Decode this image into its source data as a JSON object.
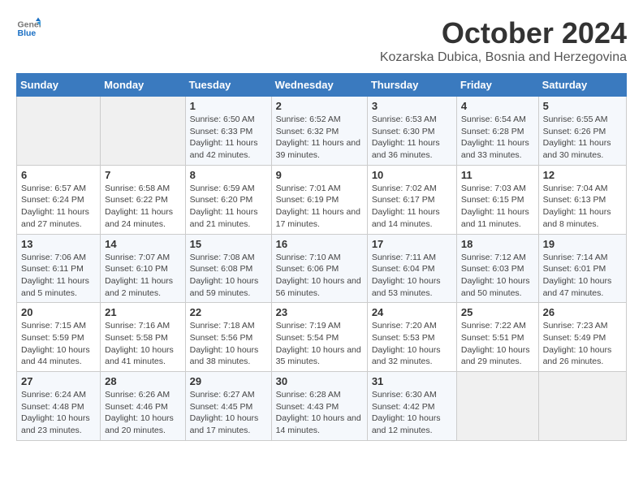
{
  "header": {
    "logo_general": "General",
    "logo_blue": "Blue",
    "month_year": "October 2024",
    "location": "Kozarska Dubica, Bosnia and Herzegovina"
  },
  "weekdays": [
    "Sunday",
    "Monday",
    "Tuesday",
    "Wednesday",
    "Thursday",
    "Friday",
    "Saturday"
  ],
  "weeks": [
    [
      {
        "day": "",
        "info": ""
      },
      {
        "day": "",
        "info": ""
      },
      {
        "day": "1",
        "info": "Sunrise: 6:50 AM\nSunset: 6:33 PM\nDaylight: 11 hours and 42 minutes."
      },
      {
        "day": "2",
        "info": "Sunrise: 6:52 AM\nSunset: 6:32 PM\nDaylight: 11 hours and 39 minutes."
      },
      {
        "day": "3",
        "info": "Sunrise: 6:53 AM\nSunset: 6:30 PM\nDaylight: 11 hours and 36 minutes."
      },
      {
        "day": "4",
        "info": "Sunrise: 6:54 AM\nSunset: 6:28 PM\nDaylight: 11 hours and 33 minutes."
      },
      {
        "day": "5",
        "info": "Sunrise: 6:55 AM\nSunset: 6:26 PM\nDaylight: 11 hours and 30 minutes."
      }
    ],
    [
      {
        "day": "6",
        "info": "Sunrise: 6:57 AM\nSunset: 6:24 PM\nDaylight: 11 hours and 27 minutes."
      },
      {
        "day": "7",
        "info": "Sunrise: 6:58 AM\nSunset: 6:22 PM\nDaylight: 11 hours and 24 minutes."
      },
      {
        "day": "8",
        "info": "Sunrise: 6:59 AM\nSunset: 6:20 PM\nDaylight: 11 hours and 21 minutes."
      },
      {
        "day": "9",
        "info": "Sunrise: 7:01 AM\nSunset: 6:19 PM\nDaylight: 11 hours and 17 minutes."
      },
      {
        "day": "10",
        "info": "Sunrise: 7:02 AM\nSunset: 6:17 PM\nDaylight: 11 hours and 14 minutes."
      },
      {
        "day": "11",
        "info": "Sunrise: 7:03 AM\nSunset: 6:15 PM\nDaylight: 11 hours and 11 minutes."
      },
      {
        "day": "12",
        "info": "Sunrise: 7:04 AM\nSunset: 6:13 PM\nDaylight: 11 hours and 8 minutes."
      }
    ],
    [
      {
        "day": "13",
        "info": "Sunrise: 7:06 AM\nSunset: 6:11 PM\nDaylight: 11 hours and 5 minutes."
      },
      {
        "day": "14",
        "info": "Sunrise: 7:07 AM\nSunset: 6:10 PM\nDaylight: 11 hours and 2 minutes."
      },
      {
        "day": "15",
        "info": "Sunrise: 7:08 AM\nSunset: 6:08 PM\nDaylight: 10 hours and 59 minutes."
      },
      {
        "day": "16",
        "info": "Sunrise: 7:10 AM\nSunset: 6:06 PM\nDaylight: 10 hours and 56 minutes."
      },
      {
        "day": "17",
        "info": "Sunrise: 7:11 AM\nSunset: 6:04 PM\nDaylight: 10 hours and 53 minutes."
      },
      {
        "day": "18",
        "info": "Sunrise: 7:12 AM\nSunset: 6:03 PM\nDaylight: 10 hours and 50 minutes."
      },
      {
        "day": "19",
        "info": "Sunrise: 7:14 AM\nSunset: 6:01 PM\nDaylight: 10 hours and 47 minutes."
      }
    ],
    [
      {
        "day": "20",
        "info": "Sunrise: 7:15 AM\nSunset: 5:59 PM\nDaylight: 10 hours and 44 minutes."
      },
      {
        "day": "21",
        "info": "Sunrise: 7:16 AM\nSunset: 5:58 PM\nDaylight: 10 hours and 41 minutes."
      },
      {
        "day": "22",
        "info": "Sunrise: 7:18 AM\nSunset: 5:56 PM\nDaylight: 10 hours and 38 minutes."
      },
      {
        "day": "23",
        "info": "Sunrise: 7:19 AM\nSunset: 5:54 PM\nDaylight: 10 hours and 35 minutes."
      },
      {
        "day": "24",
        "info": "Sunrise: 7:20 AM\nSunset: 5:53 PM\nDaylight: 10 hours and 32 minutes."
      },
      {
        "day": "25",
        "info": "Sunrise: 7:22 AM\nSunset: 5:51 PM\nDaylight: 10 hours and 29 minutes."
      },
      {
        "day": "26",
        "info": "Sunrise: 7:23 AM\nSunset: 5:49 PM\nDaylight: 10 hours and 26 minutes."
      }
    ],
    [
      {
        "day": "27",
        "info": "Sunrise: 6:24 AM\nSunset: 4:48 PM\nDaylight: 10 hours and 23 minutes."
      },
      {
        "day": "28",
        "info": "Sunrise: 6:26 AM\nSunset: 4:46 PM\nDaylight: 10 hours and 20 minutes."
      },
      {
        "day": "29",
        "info": "Sunrise: 6:27 AM\nSunset: 4:45 PM\nDaylight: 10 hours and 17 minutes."
      },
      {
        "day": "30",
        "info": "Sunrise: 6:28 AM\nSunset: 4:43 PM\nDaylight: 10 hours and 14 minutes."
      },
      {
        "day": "31",
        "info": "Sunrise: 6:30 AM\nSunset: 4:42 PM\nDaylight: 10 hours and 12 minutes."
      },
      {
        "day": "",
        "info": ""
      },
      {
        "day": "",
        "info": ""
      }
    ]
  ]
}
